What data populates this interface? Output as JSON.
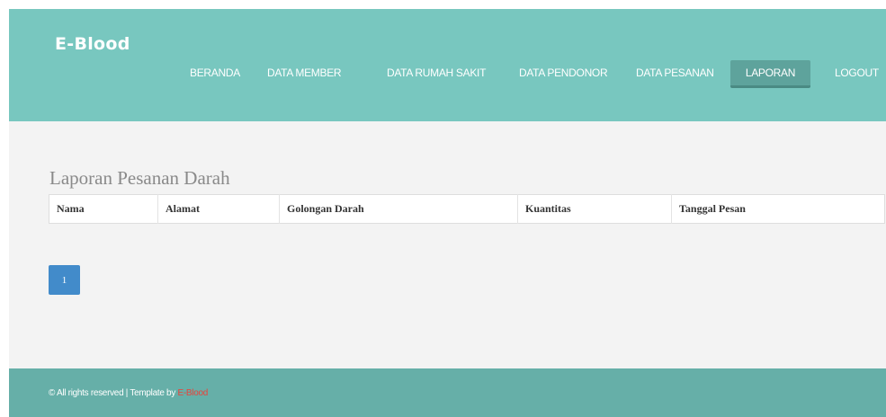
{
  "header": {
    "brand": "E-Blood",
    "nav": [
      {
        "label": "BERANDA",
        "active": false
      },
      {
        "label": "DATA MEMBER",
        "active": false
      },
      {
        "label": "DATA RUMAH SAKIT",
        "active": false
      },
      {
        "label": "DATA PENDONOR",
        "active": false
      },
      {
        "label": "DATA PESANAN",
        "active": false
      },
      {
        "label": "LAPORAN",
        "active": true
      },
      {
        "label": "LOGOUT",
        "active": false
      }
    ]
  },
  "main": {
    "title": "Laporan Pesanan Darah",
    "table": {
      "columns": [
        "Nama",
        "Alamat",
        "Golongan Darah",
        "Kuantitas",
        "Tanggal Pesan"
      ]
    },
    "pagination": {
      "current": "1"
    }
  },
  "footer": {
    "text": "© All rights reserved | Template by ",
    "link": "E-Blood"
  },
  "colors": {
    "header_bg": "#78c7bf",
    "nav_active_bg": "#5ea39c",
    "content_bg": "#f3f3f3",
    "footer_bg": "#66afa8",
    "pagination_active": "#428bca",
    "footer_link": "#e8433b"
  }
}
